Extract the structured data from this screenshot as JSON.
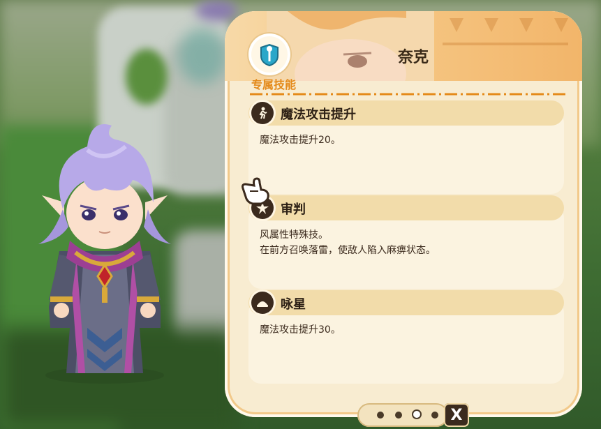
{
  "panel": {
    "title": "奈克",
    "section_label": "专属技能"
  },
  "skills": [
    {
      "name": "魔法攻击提升",
      "desc": "魔法攻击提升20。",
      "icon": "running-figure-icon"
    },
    {
      "name": "审判",
      "desc": "风属性特殊技。\n在前方召唤落雷，使敌人陷入麻痹状态。",
      "icon": "lightning-burst-icon"
    },
    {
      "name": "咏星",
      "desc": "魔法攻击提升30。",
      "icon": "magic-hat-icon"
    }
  ],
  "pager": {
    "page_count": 4,
    "active_page": 3
  },
  "close_button": {
    "label": "X"
  },
  "colors": {
    "accent": "#e48a1a",
    "panel_bg": "#f8ecd1",
    "bar_bg": "#f2dcaa",
    "dark": "#3b2a1d"
  }
}
